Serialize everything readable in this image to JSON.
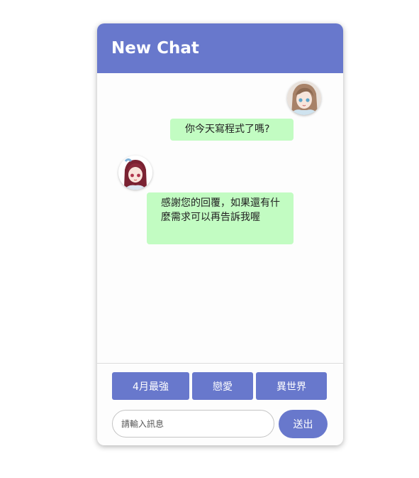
{
  "header": {
    "title": "New Chat"
  },
  "messages": [
    {
      "sender": "user",
      "text": "你今天寫程式了嗎?"
    },
    {
      "sender": "bot",
      "text": "感謝您的回覆，如果還有什麼需求可以再告訴我喔"
    }
  ],
  "quick_replies": [
    "4月最強",
    "戀愛",
    "異世界"
  ],
  "composer": {
    "placeholder": "請輸入訊息",
    "value": "",
    "send_label": "送出"
  },
  "colors": {
    "accent": "#6878cc",
    "bubble": "#c2fcc2"
  }
}
